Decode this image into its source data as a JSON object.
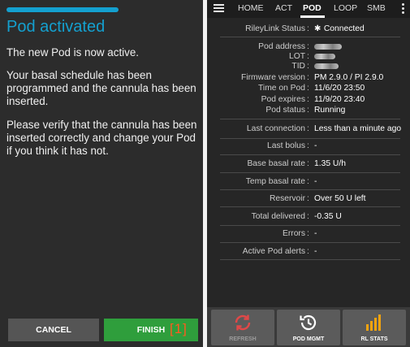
{
  "left": {
    "title": "Pod activated",
    "paragraphs": [
      "The new Pod is now active.",
      "Your basal schedule has been programmed and the cannula has been inserted.",
      "Please verify that the cannula has been inserted correctly and change your Pod if you think it has not."
    ],
    "cancel_label": "CANCEL",
    "finish_label": "FINISH",
    "marker": "[1]",
    "colors": {
      "accent": "#14a0cf",
      "finish": "#2f9e3c",
      "cancel": "#555555",
      "marker": "#ff5a1f"
    }
  },
  "right": {
    "tabs": [
      "HOME",
      "ACT",
      "POD",
      "LOOP",
      "SMB"
    ],
    "active_tab": "POD",
    "rows": {
      "rileylink_label": "RileyLink Status",
      "rileylink_value": "Connected",
      "pod_address_label": "Pod address",
      "lot_label": "LOT",
      "tid_label": "TID",
      "firmware_label": "Firmware version",
      "firmware_value": "PM 2.9.0 / PI 2.9.0",
      "time_on_pod_label": "Time on Pod",
      "time_on_pod_value": "11/6/20 23:50",
      "pod_expires_label": "Pod expires",
      "pod_expires_value": "11/9/20 23:40",
      "pod_status_label": "Pod status",
      "pod_status_value": "Running",
      "last_connection_label": "Last connection",
      "last_connection_value": "Less than a minute ago",
      "last_bolus_label": "Last bolus",
      "last_bolus_value": "-",
      "base_basal_label": "Base basal rate",
      "base_basal_value": "1.35 U/h",
      "temp_basal_label": "Temp basal rate",
      "temp_basal_value": "-",
      "reservoir_label": "Reservoir",
      "reservoir_value": "Over 50 U left",
      "total_delivered_label": "Total delivered",
      "total_delivered_value": "-0.35 U",
      "errors_label": "Errors",
      "errors_value": "-",
      "active_alerts_label": "Active Pod alerts",
      "active_alerts_value": "-",
      "separator": ":"
    },
    "actions": {
      "refresh_label": "REFRESH",
      "pod_mgmt_label": "POD MGMT",
      "rl_stats_label": "RL STATS"
    },
    "icons": [
      "menu-icon",
      "bluetooth-icon",
      "refresh-icon",
      "history-icon",
      "bar-chart-icon",
      "overflow-menu-icon"
    ]
  }
}
